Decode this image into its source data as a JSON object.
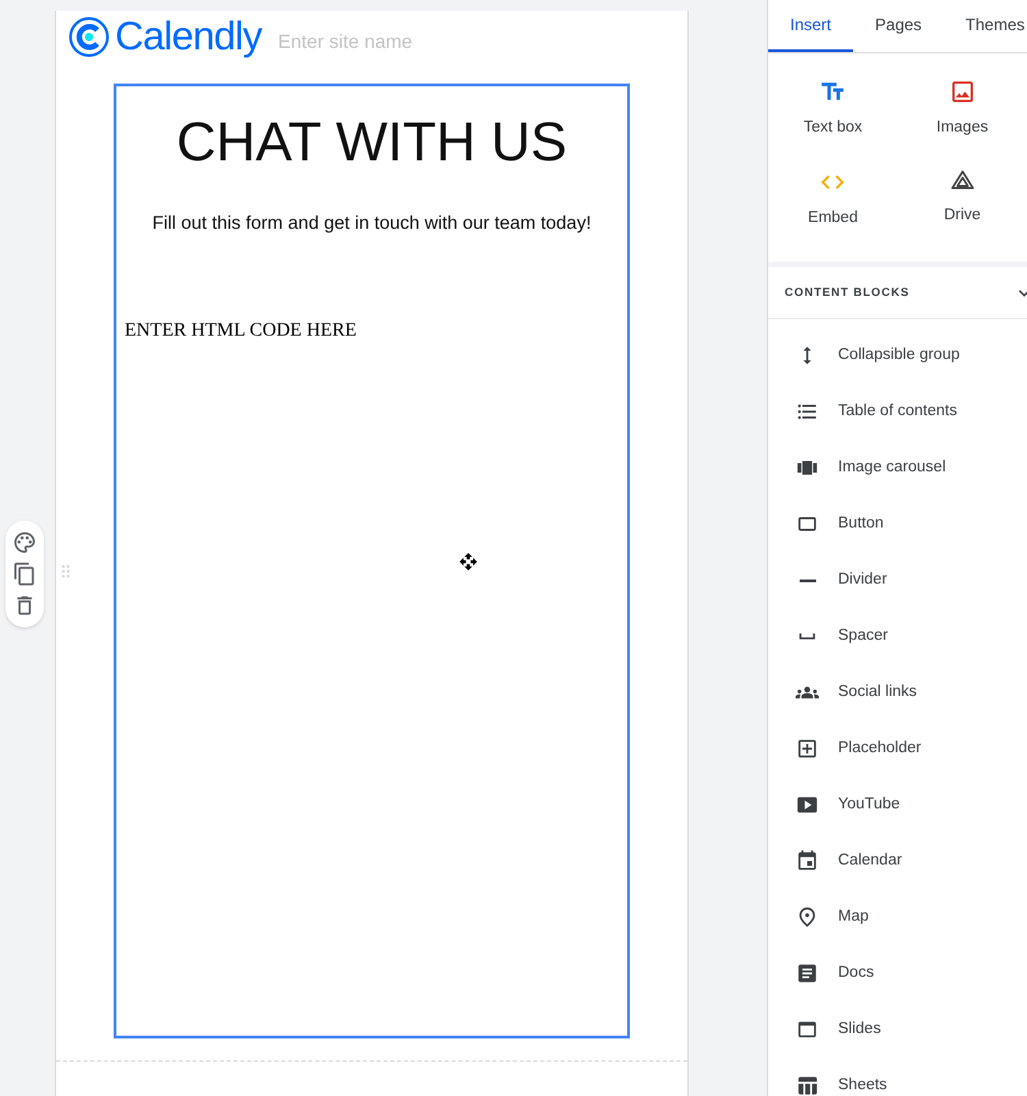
{
  "site": {
    "logo_text": "Calendly",
    "site_name_placeholder": "Enter site name"
  },
  "section": {
    "heading": "CHAT WITH US",
    "subheading": "Fill out this form and get in touch with our team today!",
    "embed_text": "ENTER HTML CODE HERE"
  },
  "tabs": [
    {
      "label": "Insert",
      "selected": true
    },
    {
      "label": "Pages",
      "selected": false
    },
    {
      "label": "Themes",
      "selected": false
    }
  ],
  "insert_tiles": [
    "Text box",
    "Images",
    "Embed",
    "Drive"
  ],
  "content_blocks": {
    "title": "CONTENT BLOCKS",
    "expanded": true,
    "items": [
      "Collapsible group",
      "Table of contents",
      "Image carousel",
      "Button",
      "Divider",
      "Spacer",
      "Social links",
      "Placeholder",
      "YouTube",
      "Calendar",
      "Map",
      "Docs",
      "Slides",
      "Sheets"
    ]
  }
}
